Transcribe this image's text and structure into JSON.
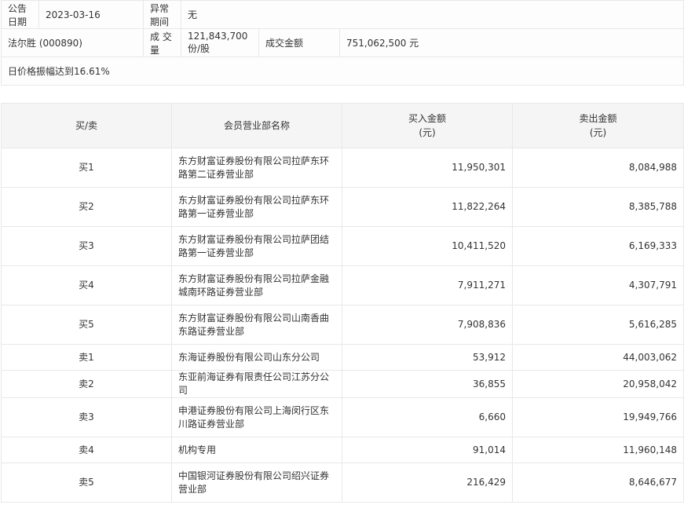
{
  "info": {
    "announce_date_label": "公告日期",
    "announce_date": "2023-03-16",
    "abnormal_period_label": "异常期间",
    "abnormal_period": "无",
    "stock": "法尔胜 (000890)",
    "volume_label": "成 交 量",
    "volume": "121,843,700 份/股",
    "amount_label": "成交金额",
    "amount": "751,062,500 元",
    "reason": "日价格振幅达到16.61%"
  },
  "table": {
    "headers": {
      "side": "买/卖",
      "branch": "会员营业部名称",
      "buy": "买入金额",
      "buy_unit": "(元)",
      "sell": "卖出金额",
      "sell_unit": "(元)"
    },
    "rows": [
      {
        "side": "买1",
        "branch": "东方财富证券股份有限公司拉萨东环路第二证券营业部",
        "buy": "11,950,301",
        "sell": "8,084,988"
      },
      {
        "side": "买2",
        "branch": "东方财富证券股份有限公司拉萨东环路第一证券营业部",
        "buy": "11,822,264",
        "sell": "8,385,788"
      },
      {
        "side": "买3",
        "branch": "东方财富证券股份有限公司拉萨团结路第一证券营业部",
        "buy": "10,411,520",
        "sell": "6,169,333"
      },
      {
        "side": "买4",
        "branch": "东方财富证券股份有限公司拉萨金融城南环路证券营业部",
        "buy": "7,911,271",
        "sell": "4,307,791"
      },
      {
        "side": "买5",
        "branch": "东方财富证券股份有限公司山南香曲东路证券营业部",
        "buy": "7,908,836",
        "sell": "5,616,285"
      },
      {
        "side": "卖1",
        "branch": "东海证券股份有限公司山东分公司",
        "buy": "53,912",
        "sell": "44,003,062"
      },
      {
        "side": "卖2",
        "branch": "东亚前海证券有限责任公司江苏分公司",
        "buy": "36,855",
        "sell": "20,958,042"
      },
      {
        "side": "卖3",
        "branch": "申港证券股份有限公司上海闵行区东川路证券营业部",
        "buy": "6,660",
        "sell": "19,949,766"
      },
      {
        "side": "卖4",
        "branch": "机构专用",
        "buy": "91,014",
        "sell": "11,960,148"
      },
      {
        "side": "卖5",
        "branch": "中国银河证券股份有限公司绍兴证券营业部",
        "buy": "216,429",
        "sell": "8,646,677"
      }
    ]
  }
}
